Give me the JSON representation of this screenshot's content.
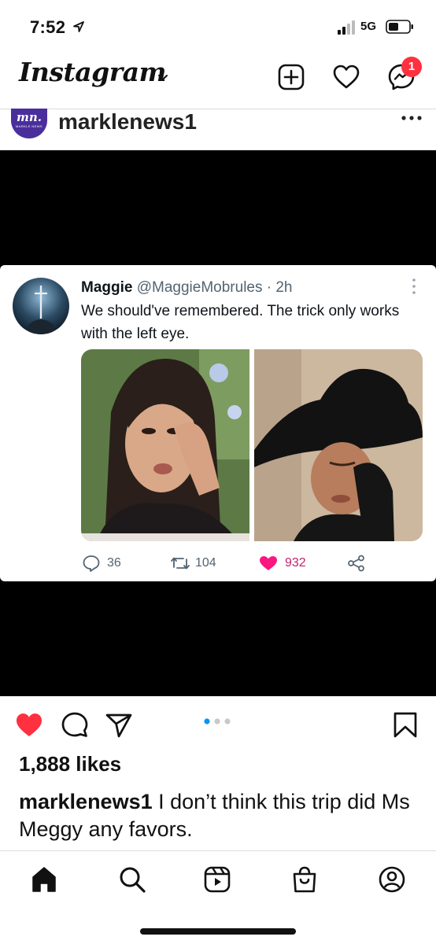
{
  "status_bar": {
    "time": "7:52",
    "network": "5G",
    "icons": [
      "location-arrow-icon",
      "signal-icon",
      "battery-icon"
    ]
  },
  "header": {
    "logo": "Instagram",
    "notification_badge": "1",
    "icons": [
      "chevron-down-icon",
      "new-post-icon",
      "heart-icon",
      "messenger-icon"
    ]
  },
  "post": {
    "username": "marklenews1",
    "avatar": {
      "initials": "mn.",
      "subtitle": "MARKLE NEWS"
    },
    "tweet": {
      "name": "Maggie",
      "handle": "@MaggieMobrules · 2h",
      "text": "We should've remembered. The trick only works with the left eye.",
      "replies": "36",
      "retweets": "104",
      "likes": "932"
    },
    "carousel": {
      "total": 3,
      "active": 1
    },
    "likes": "1,888 likes",
    "caption_user": "marklenews1",
    "caption_text": " I don’t think this trip did Ms Meggy any favors."
  },
  "colors": {
    "like_red": "#ff3040",
    "carousel_active": "#0095f6",
    "tweet_like_pink": "#f91880",
    "avatar_purple": "#4a2f9c"
  },
  "bottom_nav": {
    "icons": [
      "home-icon",
      "search-icon",
      "reels-icon",
      "shop-icon",
      "profile-icon"
    ]
  }
}
